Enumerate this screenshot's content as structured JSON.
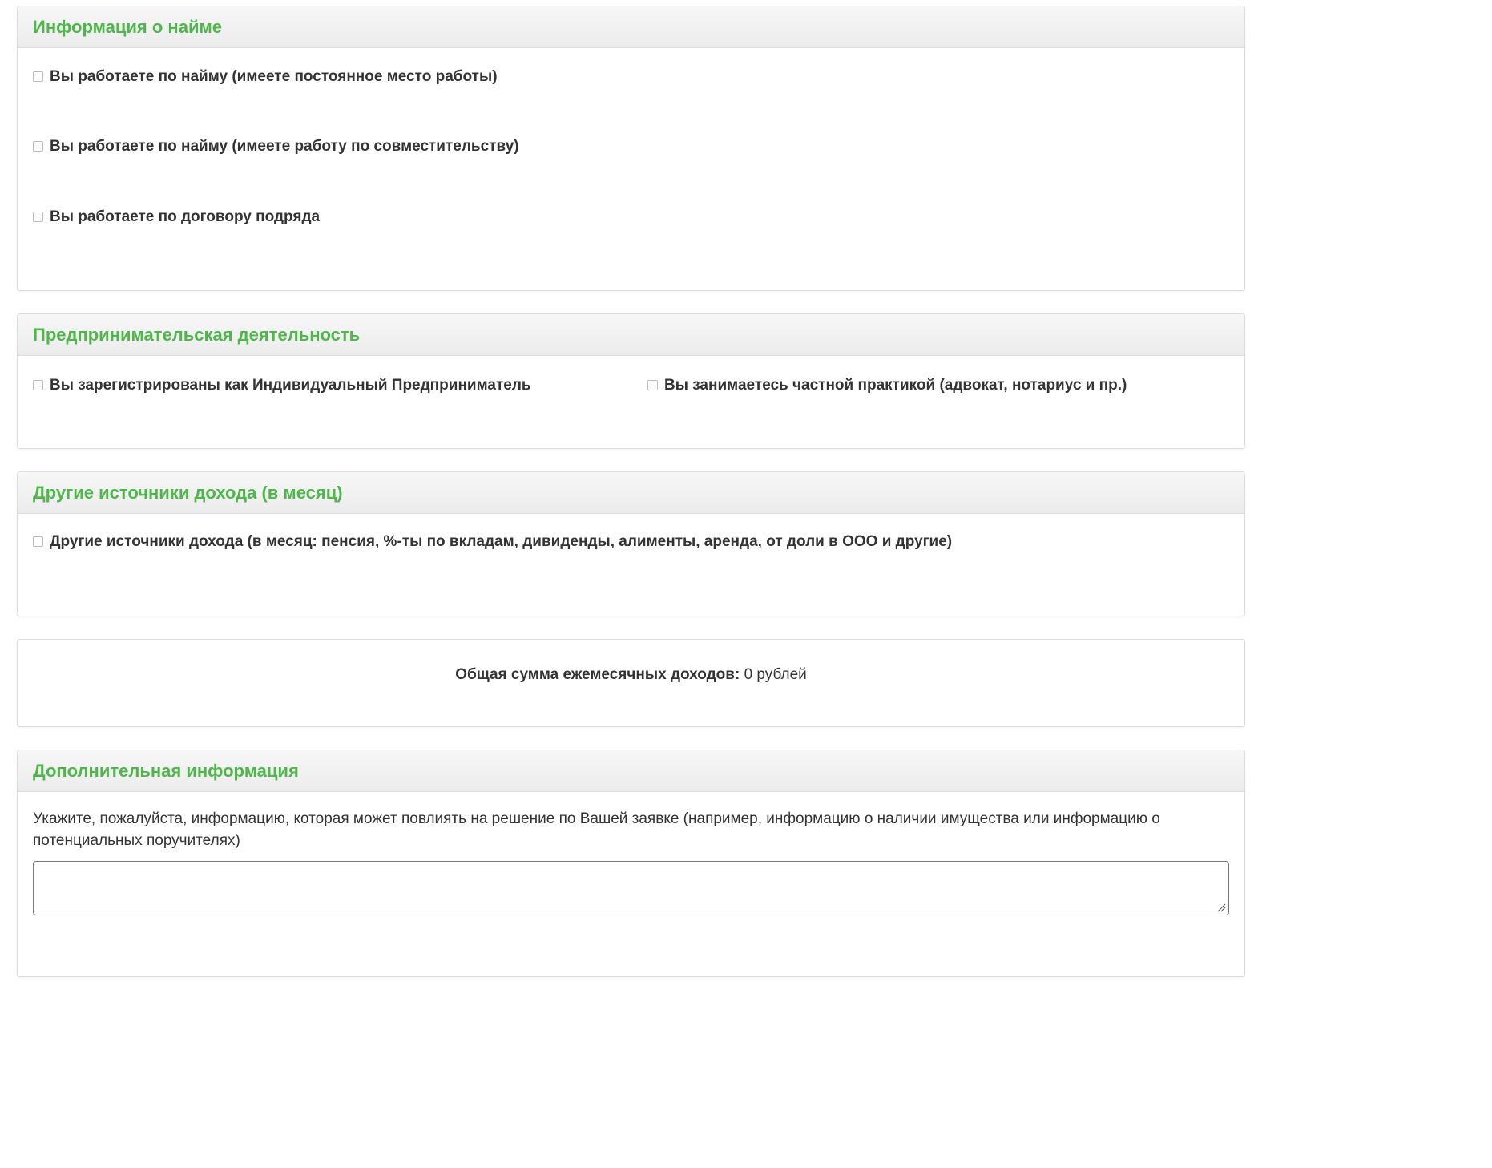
{
  "employment": {
    "title": "Информация о найме",
    "options": [
      "Вы работаете по найму (имеете постоянное место работы)",
      "Вы работаете по найму (имеете работу по совместительству)",
      "Вы работаете по договору подряда"
    ]
  },
  "business": {
    "title": "Предпринимательская деятельность",
    "options": [
      "Вы зарегистрированы как Индивидуальный Предприниматель",
      "Вы занимаетесь частной практикой (адвокат, нотариус и пр.)"
    ]
  },
  "other_income": {
    "title": "Другие источники дохода (в месяц)",
    "options": [
      "Другие источники дохода (в месяц: пенсия, %-ты по вкладам, дивиденды, алименты, аренда, от доли в ООО и другие)"
    ]
  },
  "total": {
    "label": "Общая сумма ежемесячных доходов:",
    "value": "0 рублей"
  },
  "additional": {
    "title": "Дополнительная информация",
    "help_text": "Укажите, пожалуйста, информацию, которая может повлиять на решение по Вашей заявке (например, информацию о наличии имущества или информацию о потенциальных поручителях)",
    "textarea_value": ""
  },
  "colors": {
    "accent": "#4cb848",
    "text": "#333333",
    "border": "#dddddd"
  }
}
